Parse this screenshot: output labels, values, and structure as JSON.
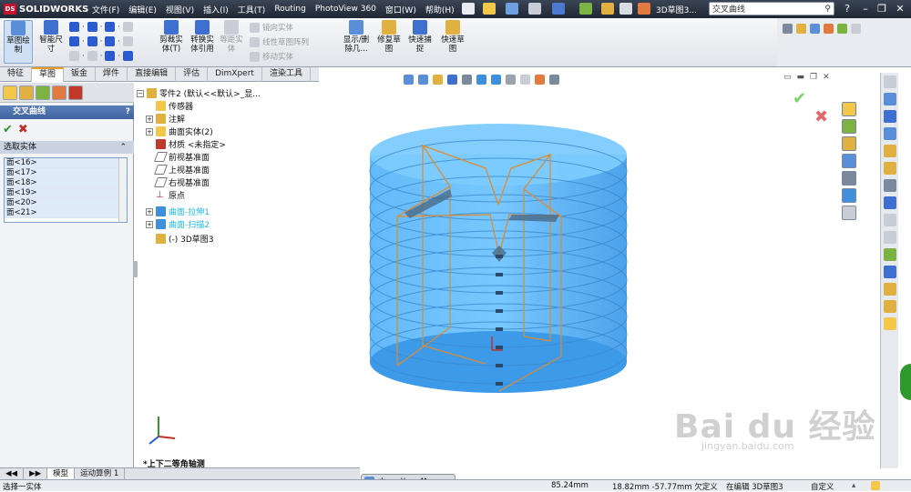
{
  "app": {
    "logo_text": "SOLIDWORKS",
    "doc_title": "3D草图3...",
    "search_value": "交叉曲线"
  },
  "menu": [
    "文件(F)",
    "编辑(E)",
    "视图(V)",
    "插入(I)",
    "工具(T)",
    "Routing",
    "PhotoView 360",
    "窗口(W)",
    "帮助(H)"
  ],
  "command_manager": {
    "sketch": "草图绘\n制",
    "smart_dim": "智能尺\n寸",
    "trim": "剪裁实\n体(T)",
    "convert": "转换实\n体引用",
    "offset": "等距实\n体",
    "mirror": "镜向实体",
    "linear_pattern": "线性草图阵列",
    "move": "移动实体",
    "show_delete": "显示/删\n除几...",
    "repair": "修复草\n图",
    "quick_snap": "快速捕\n捉",
    "rapid_sketch": "快速草\n图"
  },
  "tabs": [
    "特征",
    "草图",
    "钣金",
    "焊件",
    "直接编辑",
    "评估",
    "DimXpert",
    "渲染工具"
  ],
  "active_tab": "草图",
  "property_manager": {
    "title": "交叉曲线",
    "help": "?",
    "ok": "✔",
    "cancel": "✖",
    "section_title": "选取实体",
    "items": [
      "面<16>",
      "面<17>",
      "面<18>",
      "面<19>",
      "面<20>",
      "面<21>"
    ]
  },
  "feature_tree": {
    "root": "零件2 (默认<<默认>_显...",
    "items": [
      "传感器",
      "注解",
      "曲面实体(2)",
      "材质 <未指定>",
      "前视基准面",
      "上视基准面",
      "右视基准面",
      "原点",
      "曲面-拉伸1",
      "曲面-扫描2",
      "(-) 3D草图3"
    ]
  },
  "view_label": "*上下二等角轴测",
  "bottom_tabs": [
    "模型",
    "运动算例 1"
  ],
  "status": {
    "left": "选择一实体",
    "dim1": "85.24mm",
    "coords": "18.82mm -57.77mm 欠定义",
    "editing": "在编辑 3D草图3",
    "custom": "自定义"
  },
  "hud_items": [
    "中",
    "≈",
    "¥",
    "≈",
    "⚒"
  ],
  "watermark": {
    "main": "Bai du 经验",
    "sub": "jingyan.baidu.com"
  },
  "colors": {
    "accent": "#f29b1e",
    "model_blue": "#3fa7f5",
    "edge_orange": "#e08a2a",
    "title_bg": "#1f2733"
  }
}
